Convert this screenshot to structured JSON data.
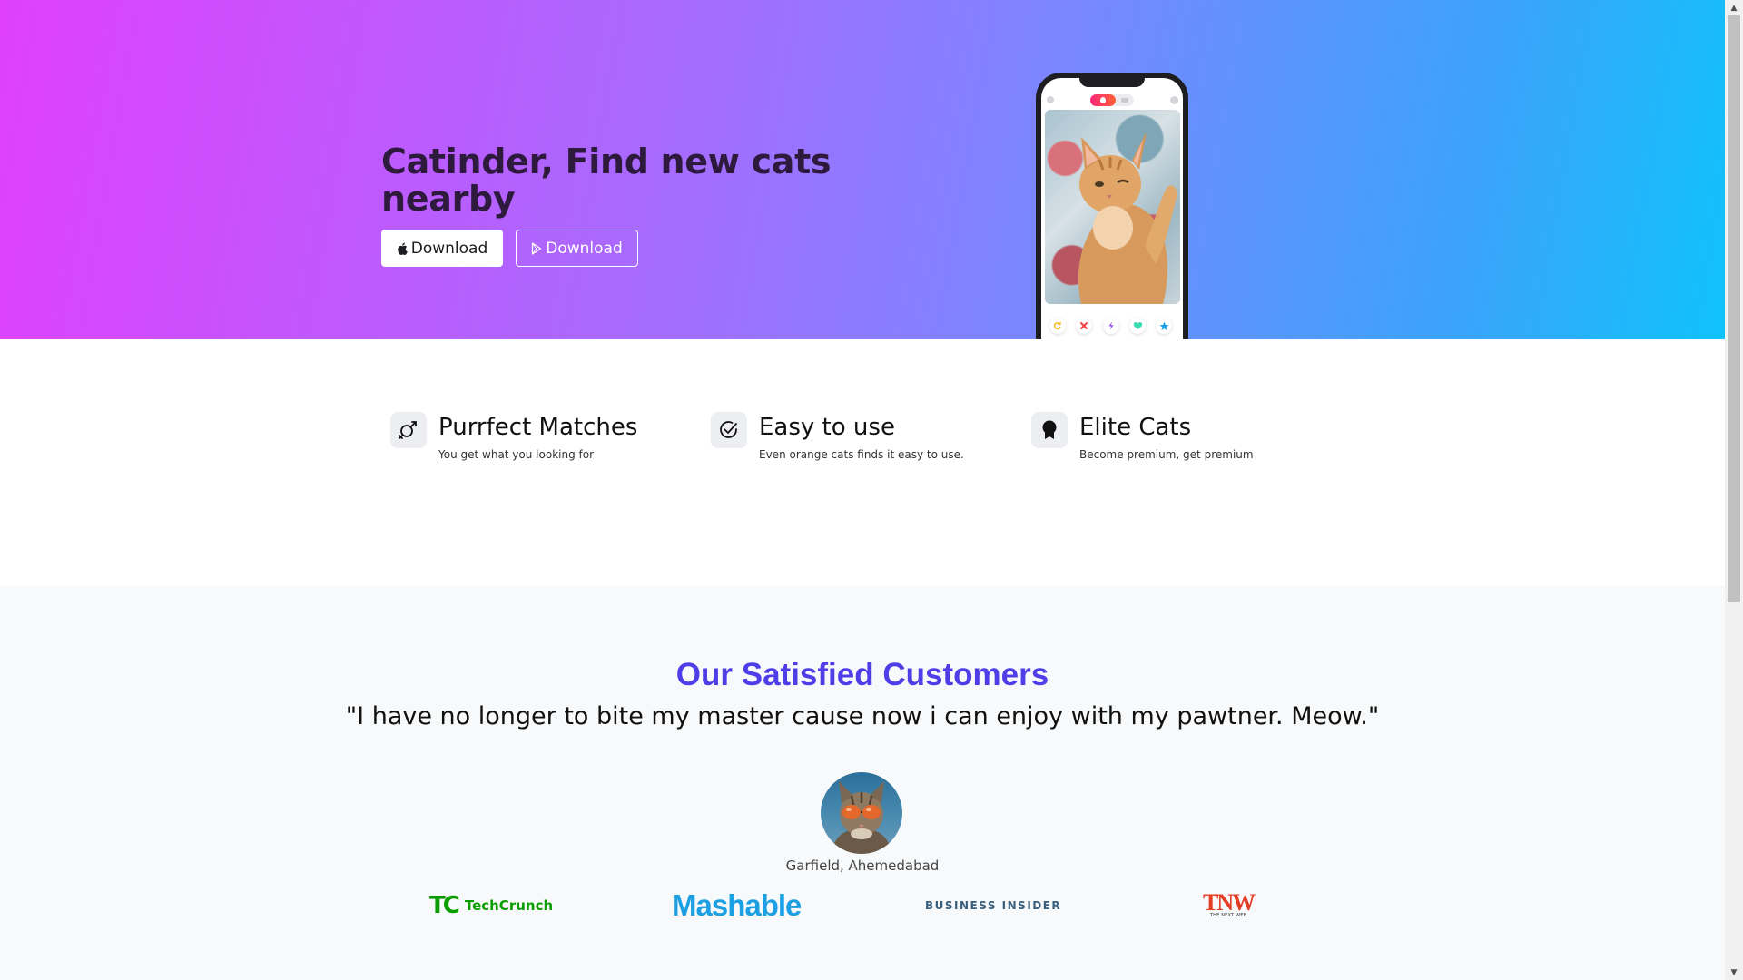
{
  "hero": {
    "title": "Catinder, Find new cats nearby",
    "buttons": {
      "apple_label": "Download",
      "play_label": "Download"
    }
  },
  "phone": {
    "actions": [
      "rewind-icon",
      "close-icon",
      "boost-icon",
      "heart-icon",
      "star-icon"
    ]
  },
  "features": [
    {
      "title": "Purrfect Matches",
      "description": "You get what you looking for",
      "icon": "gender-symbol-icon"
    },
    {
      "title": "Easy to use",
      "description": "Even orange cats finds it easy to use.",
      "icon": "check-circle-icon"
    },
    {
      "title": "Elite Cats",
      "description": "Become premium, get premium",
      "icon": "award-badge-icon"
    }
  ],
  "testimonials": {
    "heading": "Our Satisfied Customers",
    "quote": "\"I have no longer to bite my master cause now i can enjoy with my pawtner. Meow.\"",
    "author": "Garfield, Ahemedabad"
  },
  "press_logos": {
    "techcrunch_mark": "TC",
    "techcrunch_text": "TechCrunch",
    "mashable": "Mashable",
    "business_insider": "BUSINESS INSIDER",
    "tnw_mark": "TNW",
    "tnw_sub": "THE NEXT WEB"
  },
  "colors": {
    "hero_gradient_start": "#e040fb",
    "hero_gradient_end": "#10c2fb",
    "heading_accent": "#4f3ee8",
    "techcrunch_green": "#0a9e01",
    "mashable_blue": "#1da0e3",
    "tnw_red": "#e33c24"
  }
}
